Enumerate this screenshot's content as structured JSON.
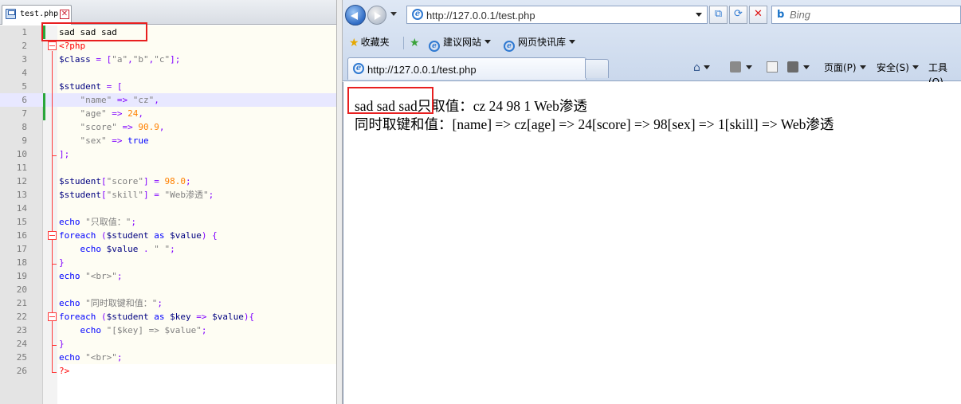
{
  "editor": {
    "tab_label": "test.php",
    "lines": [
      {
        "n": "1",
        "html": "sad sad sad"
      },
      {
        "n": "2",
        "html": "<span class=\"php\">&lt;?php</span>"
      },
      {
        "n": "3",
        "html": "<span class=\"v\">$class</span> <span class=\"o\">=</span> <span class=\"o\">[</span><span class=\"s\">\"a\"</span><span class=\"o\">,</span><span class=\"s\">\"b\"</span><span class=\"o\">,</span><span class=\"s\">\"c\"</span><span class=\"o\">];</span>"
      },
      {
        "n": "4",
        "html": ""
      },
      {
        "n": "5",
        "html": "<span class=\"v\">$student</span> <span class=\"o\">=</span> <span class=\"o\">[</span>"
      },
      {
        "n": "6",
        "html": "    <span class=\"s\">\"name\"</span> <span class=\"o\">=&gt;</span> <span class=\"s\">\"cz\"</span><span class=\"o\">,</span>"
      },
      {
        "n": "7",
        "html": "    <span class=\"s\">\"age\"</span> <span class=\"o\">=&gt;</span> <span class=\"n\">24</span><span class=\"o\">,</span>"
      },
      {
        "n": "8",
        "html": "    <span class=\"s\">\"score\"</span> <span class=\"o\">=&gt;</span> <span class=\"n\">90.9</span><span class=\"o\">,</span>"
      },
      {
        "n": "9",
        "html": "    <span class=\"s\">\"sex\"</span> <span class=\"o\">=&gt;</span> <span class=\"t\">true</span>"
      },
      {
        "n": "10",
        "html": "<span class=\"o\">];</span>"
      },
      {
        "n": "11",
        "html": ""
      },
      {
        "n": "12",
        "html": "<span class=\"v\">$student</span><span class=\"o\">[</span><span class=\"s\">\"score\"</span><span class=\"o\">]</span> <span class=\"o\">=</span> <span class=\"n\">98.0</span><span class=\"o\">;</span>"
      },
      {
        "n": "13",
        "html": "<span class=\"v\">$student</span><span class=\"o\">[</span><span class=\"s\">\"skill\"</span><span class=\"o\">]</span> <span class=\"o\">=</span> <span class=\"s\">\"Web渗透\"</span><span class=\"o\">;</span>"
      },
      {
        "n": "14",
        "html": ""
      },
      {
        "n": "15",
        "html": "<span class=\"k\">echo</span> <span class=\"s\">\"只取值：\"</span><span class=\"o\">;</span>"
      },
      {
        "n": "16",
        "html": "<span class=\"k\">foreach</span> <span class=\"o\">(</span><span class=\"v\">$student</span> <span class=\"k\">as</span> <span class=\"v\">$value</span><span class=\"o\">)</span> <span class=\"o\">{</span>"
      },
      {
        "n": "17",
        "html": "    <span class=\"k\">echo</span> <span class=\"v\">$value</span> <span class=\"o\">.</span> <span class=\"s\">\" \"</span><span class=\"o\">;</span>"
      },
      {
        "n": "18",
        "html": "<span class=\"o\">}</span>"
      },
      {
        "n": "19",
        "html": "<span class=\"k\">echo</span> <span class=\"s\">\"&lt;br&gt;\"</span><span class=\"o\">;</span>"
      },
      {
        "n": "20",
        "html": ""
      },
      {
        "n": "21",
        "html": "<span class=\"k\">echo</span> <span class=\"s\">\"同时取键和值：\"</span><span class=\"o\">;</span>"
      },
      {
        "n": "22",
        "html": "<span class=\"k\">foreach</span> <span class=\"o\">(</span><span class=\"v\">$student</span> <span class=\"k\">as</span> <span class=\"v\">$key</span> <span class=\"o\">=&gt;</span> <span class=\"v\">$value</span><span class=\"o\">){</span>"
      },
      {
        "n": "23",
        "html": "    <span class=\"k\">echo</span> <span class=\"s\">\"[$key] =&gt; $value\"</span><span class=\"o\">;</span>"
      },
      {
        "n": "24",
        "html": "<span class=\"o\">}</span>"
      },
      {
        "n": "25",
        "html": "<span class=\"k\">echo</span> <span class=\"s\">\"&lt;br&gt;\"</span><span class=\"o\">;</span>"
      },
      {
        "n": "26",
        "html": "<span class=\"php\">?&gt;</span>"
      }
    ]
  },
  "browser": {
    "address": "http://127.0.0.1/test.php",
    "search_placeholder": "Bing",
    "favorites_label": "收藏夹",
    "fav_links": [
      "建议网站",
      "网页快讯库"
    ],
    "tab_title": "http://127.0.0.1/test.php",
    "commands": [
      "页面(P)",
      "安全(S)",
      "工具(O)"
    ],
    "output": {
      "sad_text": "sad sad sad",
      "line1": "只取值：cz 24 98 1 Web渗透",
      "line2": "同时取键和值：[name] => cz[age] => 24[score] => 98[sex] => 1[skill] => Web渗透"
    }
  },
  "colors": {
    "highlight_box": "#e81f1f",
    "current_line": "#e8e8ff",
    "keyword": "#0000ff",
    "variable": "#000080",
    "string": "#808080",
    "number": "#ff8000",
    "operator": "#8000ff"
  }
}
